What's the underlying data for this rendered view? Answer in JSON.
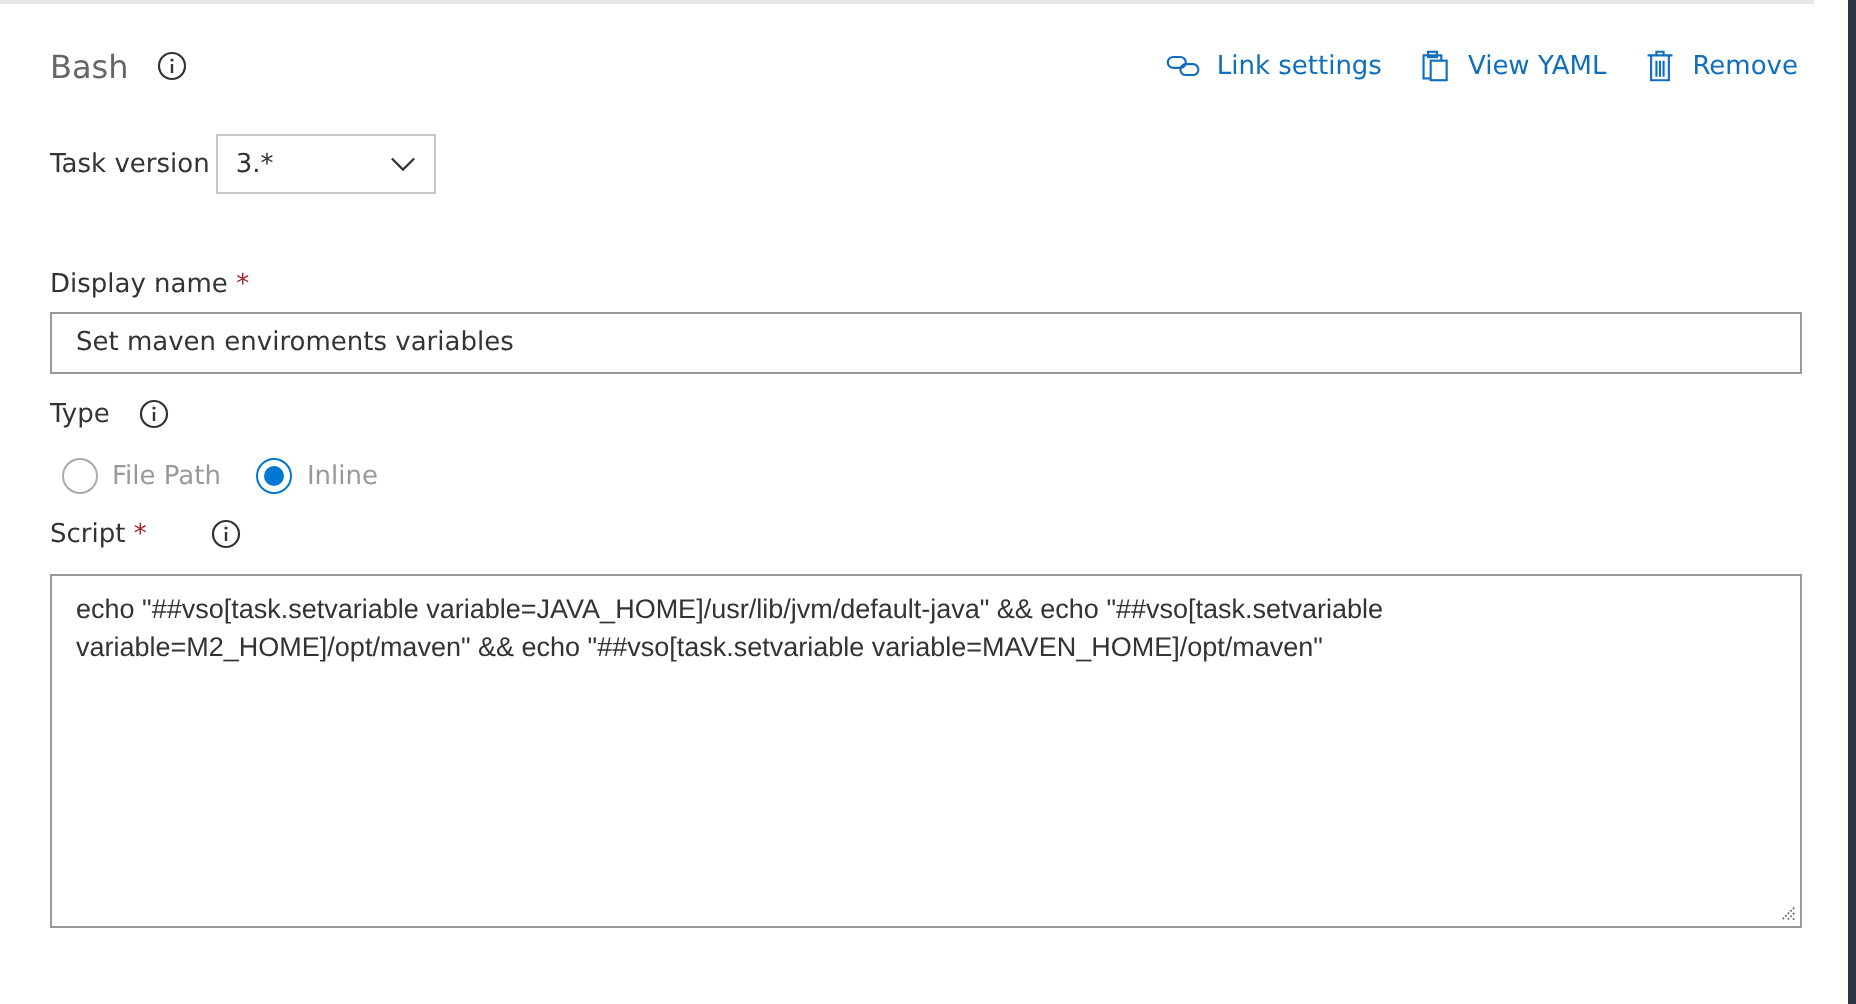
{
  "header": {
    "title": "Bash",
    "actions": [
      {
        "label": "Link settings",
        "kind": "link"
      },
      {
        "label": "View YAML",
        "kind": "clipboard"
      },
      {
        "label": "Remove",
        "kind": "trash"
      }
    ]
  },
  "task_version": {
    "label": "Task version",
    "value": "3.*"
  },
  "display_name": {
    "label": "Display name",
    "required_mark": "*",
    "value": "Set maven enviroments variables"
  },
  "type": {
    "label": "Type",
    "options": [
      {
        "label": "File Path",
        "selected": false
      },
      {
        "label": "Inline",
        "selected": true
      }
    ]
  },
  "script": {
    "label": "Script",
    "required_mark": "*",
    "value": "echo \"##vso[task.setvariable variable=JAVA_HOME]/usr/lib/jvm/default-java\" && echo \"##vso[task.setvariable variable=M2_HOME]/opt/maven\" && echo \"##vso[task.setvariable variable=MAVEN_HOME]/opt/maven\""
  }
}
